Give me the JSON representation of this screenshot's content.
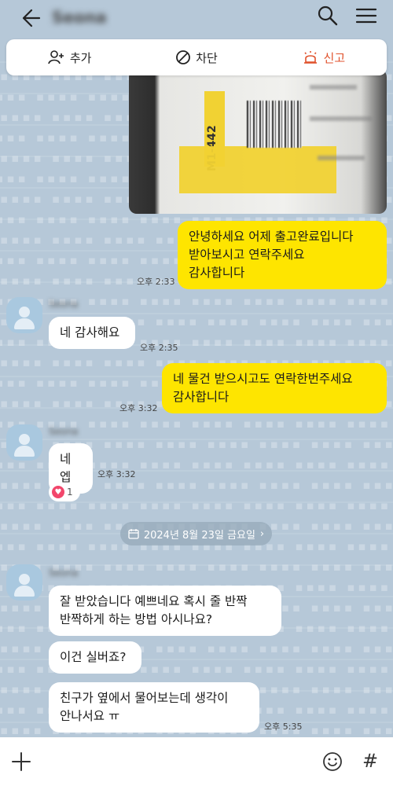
{
  "header": {
    "room_title": "Seona"
  },
  "actions": {
    "add_label": "추가",
    "block_label": "차단",
    "report_label": "신고"
  },
  "photo": {
    "label_code": "M1-442"
  },
  "messages": [
    {
      "text_lines": [
        "안녕하세요 어제 출고완료입니다",
        "받아보시고 연락주세요",
        "감사합니다"
      ],
      "time": "오후 2:33"
    },
    {
      "text_lines": [
        "네 감사해요"
      ],
      "time": "오후 2:35"
    },
    {
      "text_lines": [
        "네 물건 받으시고도 연락한번주세요",
        "감사합니다"
      ],
      "time": "오후 3:32"
    },
    {
      "text_lines": [
        "네엡"
      ],
      "time": "오후 3:32"
    },
    {
      "text_lines": [
        "잘 받았습니다 예쁘네요 혹시 줄 반짝",
        "반짝하게 하는 방법 아시나요?"
      ]
    },
    {
      "text_lines": [
        "이건 실버죠?"
      ]
    },
    {
      "text_lines": [
        "친구가 옆에서 물어보는데 생각이",
        "안나서요 ㅠ"
      ],
      "time": "오후 5:35"
    }
  ],
  "senders": [
    "Seona",
    "Seona",
    "Seona"
  ],
  "reaction": {
    "count": "1"
  },
  "date_divider": "2024년 8월 23일 금요일",
  "colors": {
    "background": "#b6c8d8",
    "my_bubble": "#fee500",
    "other_bubble": "#ffffff",
    "report": "#e0522c"
  }
}
